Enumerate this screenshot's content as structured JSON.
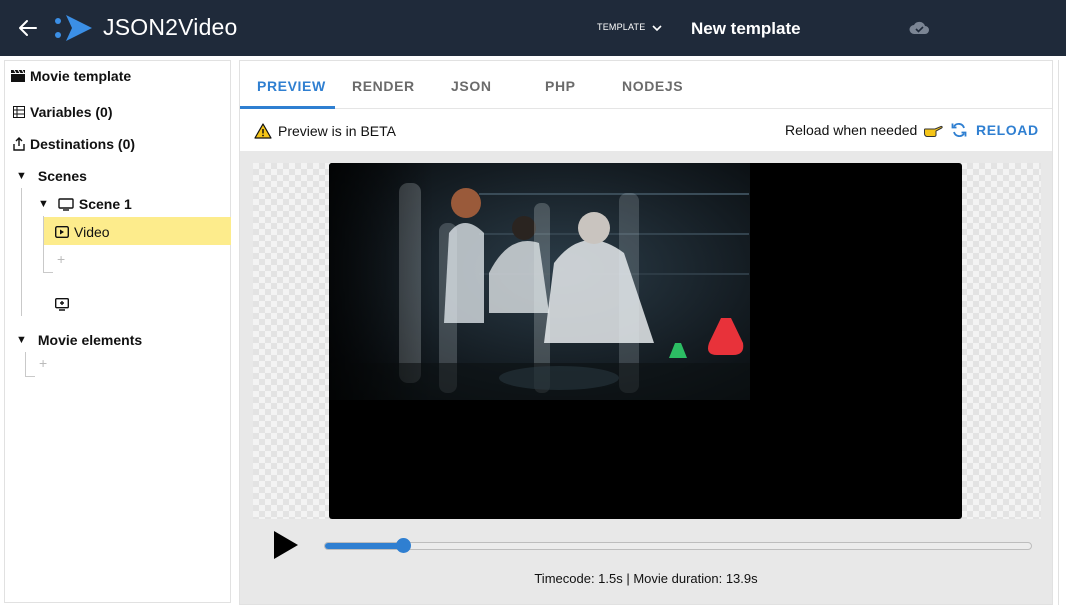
{
  "header": {
    "brand": "JSON2Video",
    "template_selector": "TEMPLATE",
    "template_name": "New template",
    "colors": {
      "background": "#1f2a3a",
      "accent": "#2f7fd1"
    }
  },
  "sidebar": {
    "movie_template": "Movie template",
    "variables": "Variables (0)",
    "destinations": "Destinations (0)",
    "scenes": "Scenes",
    "scene": "Scene 1",
    "element": "Video",
    "movie_elements": "Movie elements",
    "selected_color": "#fdec8c"
  },
  "tabs": [
    "PREVIEW",
    "RENDER",
    "JSON",
    "PHP",
    "NODEJS"
  ],
  "active_tab": "PREVIEW",
  "notice": {
    "beta": "Preview is in BETA",
    "reload_hint": "Reload when needed",
    "reload_button": "RELOAD"
  },
  "player": {
    "progress": 0.11,
    "timecode": "Timecode: 1.5s | Movie duration: 13.9s"
  }
}
